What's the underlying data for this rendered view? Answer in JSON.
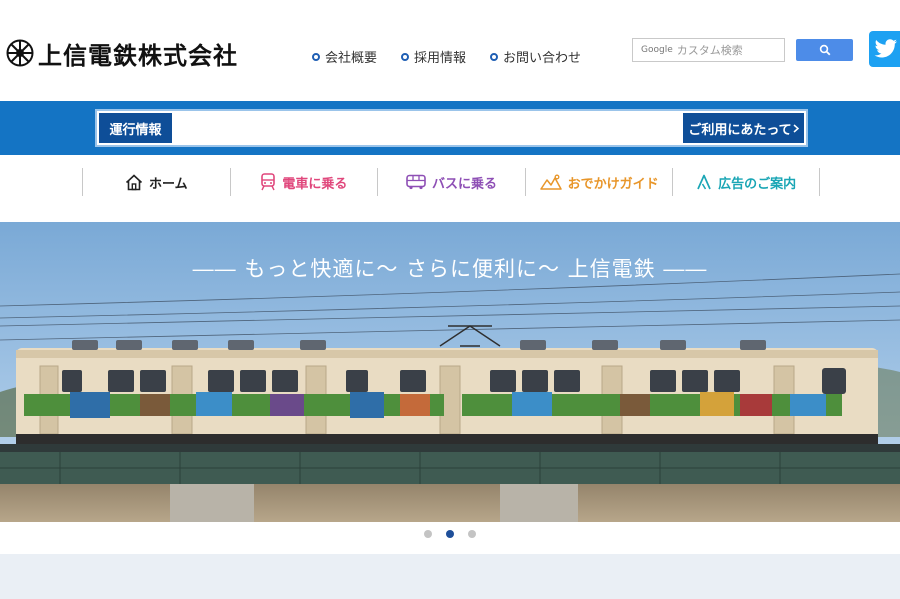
{
  "header": {
    "logo_text": "上信電鉄株式会社",
    "links": [
      {
        "label": "会社概要"
      },
      {
        "label": "採用情報"
      },
      {
        "label": "お問い合わせ"
      }
    ],
    "search": {
      "brand": "Google",
      "placeholder": "カスタム検索",
      "button_icon": "search-icon"
    },
    "social_icon": "twitter-icon"
  },
  "operation": {
    "label": "運行情報",
    "button_label": "ご利用にあたって"
  },
  "nav": {
    "items": [
      {
        "label": "ホーム",
        "icon": "home-icon",
        "color": "#222222"
      },
      {
        "label": "電車に乗る",
        "icon": "train-icon",
        "color": "#e0477c"
      },
      {
        "label": "バスに乗る",
        "icon": "bus-icon",
        "color": "#8e4fb5"
      },
      {
        "label": "おでかけガイド",
        "icon": "outing-guide-icon",
        "color": "#e8962a"
      },
      {
        "label": "広告のご案内",
        "icon": "advertising-icon",
        "color": "#1aa6b5"
      }
    ]
  },
  "hero": {
    "caption": "―― もっと快適に～ さらに便利に～ 上信電鉄 ――",
    "slide_count": 3,
    "active_slide": 2
  },
  "colors": {
    "band": "#1474c4",
    "dark_blue": "#0e4e98",
    "twitter": "#1da1f2",
    "search_button": "#4d8ce8"
  }
}
